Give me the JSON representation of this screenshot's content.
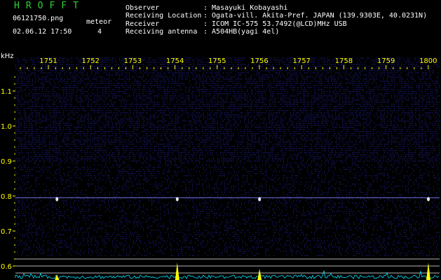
{
  "header": {
    "app_title": "HROFFT",
    "filename": "06121750.png",
    "datetime": "02.06.12 17:50",
    "meteor_label": "meteor",
    "meteor_count": "4",
    "fields": [
      {
        "label": "Observer",
        "value": ": Masayuki Kobayashi"
      },
      {
        "label": "Receiving Location",
        "value": ": Ogata-vill. Akita-Pref. JAPAN (139.9303E, 40.0231N)"
      },
      {
        "label": "Receiver",
        "value": ": ICOM IC-575 53.7492(@LCD)MHz USB"
      },
      {
        "label": "Receiving antenna",
        "value": ": A504HB(yagi 4el)"
      }
    ]
  },
  "chart_data": {
    "type": "heatmap",
    "ylabel": "kHz",
    "x_ticks": [
      "1751",
      "1752",
      "1753",
      "1754",
      "1755",
      "1756",
      "1757",
      "1758",
      "1759",
      "1800"
    ],
    "y_ticks": [
      "1.1",
      "1.0",
      "0.9",
      "0.8",
      "0.7",
      "0.6"
    ],
    "y_range_khz": [
      0.58,
      1.19
    ],
    "carrier_khz": 0.795,
    "meteor_pings_minutes_after_1750": [
      1.2,
      4.05,
      6.0,
      10.0
    ]
  },
  "colors": {
    "background": "#000000",
    "noise": "#14145a",
    "tick": "#ffff00",
    "carrier": "#5a5ab4",
    "ping": "#ffffff",
    "amplitude": "#00e5ff",
    "amplitude_peak": "#ffff00",
    "guide": "#b4b4b4"
  }
}
